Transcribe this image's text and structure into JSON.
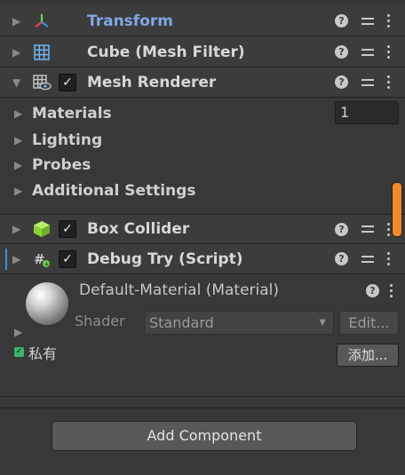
{
  "components": [
    {
      "title": "Transform",
      "icon": "transform-axes-icon",
      "has_checkbox": false
    },
    {
      "title": "Cube (Mesh Filter)",
      "icon": "mesh-filter-grid-icon",
      "has_checkbox": false
    },
    {
      "title": "Mesh Renderer",
      "icon": "mesh-renderer-icon",
      "has_checkbox": true,
      "checked": true
    },
    {
      "title": "Box Collider",
      "icon": "box-collider-cube-icon",
      "has_checkbox": true,
      "checked": true
    },
    {
      "title": "Debug Try (Script)",
      "icon": "script-icon",
      "has_checkbox": true,
      "checked": true
    }
  ],
  "mesh_renderer": {
    "sections": [
      "Materials",
      "Lighting",
      "Probes",
      "Additional Settings"
    ],
    "materials_count": "1"
  },
  "material": {
    "title": "Default-Material (Material)",
    "shader_label": "Shader",
    "shader_value": "Standard",
    "edit_label": "Edit..."
  },
  "private_section": {
    "label": "私有",
    "add_button": "添加..."
  },
  "footer": {
    "add_component_label": "Add Component"
  },
  "icons": {
    "help": "?",
    "checkmark": "✓",
    "fold_collapsed": "▶",
    "fold_expanded": "▼"
  },
  "colors": {
    "link_title": "#7fa6e6",
    "scrollbar": "#f08a2b",
    "collider_green": "#8bd13a",
    "selection_marker": "#3d8fd8"
  }
}
